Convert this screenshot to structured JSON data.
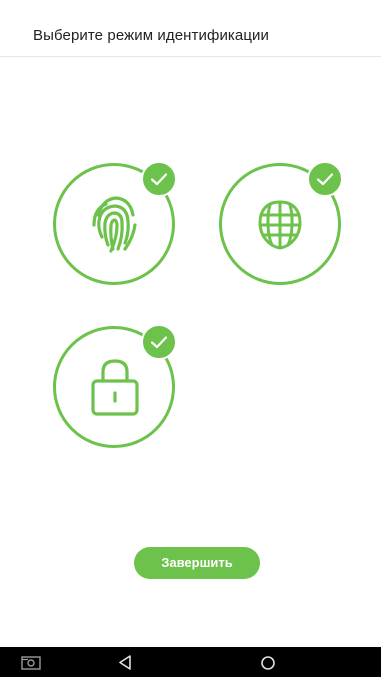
{
  "header": {
    "title": "Выберите режим идентификации"
  },
  "modes": [
    {
      "id": "fingerprint",
      "icon": "fingerprint-icon",
      "selected": true
    },
    {
      "id": "face",
      "icon": "face-icon",
      "selected": true
    },
    {
      "id": "password",
      "icon": "lock-icon",
      "selected": true
    }
  ],
  "actions": {
    "finish_label": "Завершить"
  },
  "navbar": {
    "items": [
      "screenshot-icon",
      "back-icon",
      "home-icon"
    ]
  },
  "colors": {
    "accent": "#6cc24a",
    "navbar": "#000000",
    "header_text": "#222222"
  }
}
